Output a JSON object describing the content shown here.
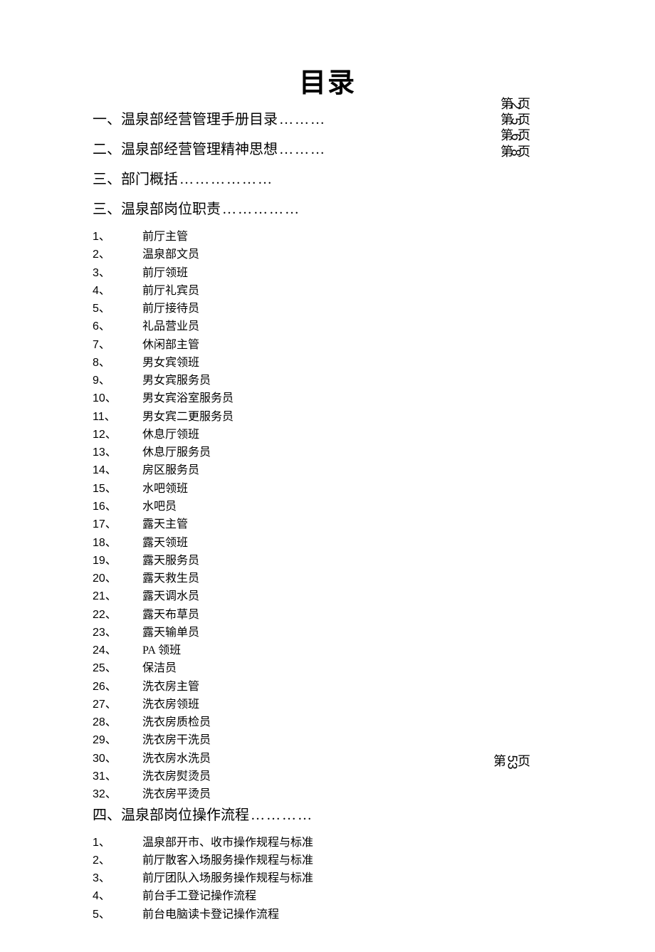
{
  "title": "目录",
  "sections": [
    {
      "num": "一、",
      "label": "温泉部经营管理手册目录",
      "dots": "………"
    },
    {
      "num": "二、",
      "label": "温泉部经营管理精神思想",
      "dots": "………"
    },
    {
      "num": "三、",
      "label": "部门概括",
      "dots": "………………"
    },
    {
      "num": "三、",
      "label": "温泉部岗位职责",
      "dots": "……………"
    }
  ],
  "sub3": [
    {
      "n": "1、",
      "t": "前厅主管"
    },
    {
      "n": "2、",
      "t": "温泉部文员"
    },
    {
      "n": "3、",
      "t": "前厅领班"
    },
    {
      "n": "4、",
      "t": "前厅礼宾员"
    },
    {
      "n": "5、",
      "t": "前厅接待员"
    },
    {
      "n": "6、",
      "t": "礼品营业员"
    },
    {
      "n": "7、",
      "t": "休闲部主管"
    },
    {
      "n": "8、",
      "t": "男女宾领班"
    },
    {
      "n": "9、",
      "t": "男女宾服务员"
    },
    {
      "n": "10、",
      "t": "男女宾浴室服务员"
    },
    {
      "n": "11、",
      "t": "男女宾二更服务员"
    },
    {
      "n": "12、",
      "t": "休息厅领班"
    },
    {
      "n": "13、",
      "t": "休息厅服务员"
    },
    {
      "n": "14、",
      "t": "房区服务员"
    },
    {
      "n": "15、",
      "t": "水吧领班"
    },
    {
      "n": "16、",
      "t": "水吧员"
    },
    {
      "n": "17、",
      "t": "露天主管"
    },
    {
      "n": "18、",
      "t": "露天领班"
    },
    {
      "n": "19、",
      "t": "露天服务员"
    },
    {
      "n": "20、",
      "t": "露天救生员"
    },
    {
      "n": "21、",
      "t": "露天调水员"
    },
    {
      "n": "22、",
      "t": "露天布草员"
    },
    {
      "n": "23、",
      "t": "露天输单员"
    },
    {
      "n": "24、",
      "t": "PA 领班"
    },
    {
      "n": "25、",
      "t": "保洁员"
    },
    {
      "n": "26、",
      "t": "洗衣房主管"
    },
    {
      "n": "27、",
      "t": "洗衣房领班"
    },
    {
      "n": "28、",
      "t": "洗衣房质检员"
    },
    {
      "n": "29、",
      "t": "洗衣房干洗员"
    },
    {
      "n": "30、",
      "t": "洗衣房水洗员"
    },
    {
      "n": "31、",
      "t": "洗衣房熨烫员"
    },
    {
      "n": "32、",
      "t": "洗衣房平烫员"
    }
  ],
  "section4": {
    "num": "四、",
    "label": "温泉部岗位操作流程",
    "dots": "…………"
  },
  "sub4": [
    {
      "n": "1、",
      "t": "温泉部开市、收市操作规程与标准"
    },
    {
      "n": "2、",
      "t": "前厅散客入场服务操作规程与标准"
    },
    {
      "n": "3、",
      "t": "前厅团队入场服务操作规程与标准"
    },
    {
      "n": "4、",
      "t": "前台手工登记操作流程"
    },
    {
      "n": "5、",
      "t": "前台电脑读卡登记操作流程"
    }
  ],
  "pageRefsTop": [
    {
      "prefix": "第",
      "num": "2",
      "suffix": "页"
    },
    {
      "prefix": "第",
      "num": "5",
      "suffix": "页"
    },
    {
      "prefix": "第",
      "num": "6",
      "suffix": "页"
    },
    {
      "prefix": "第",
      "num": "8",
      "suffix": "页"
    }
  ],
  "pageRefBottom": {
    "prefix": "第",
    "num": "53",
    "suffix": "页"
  }
}
